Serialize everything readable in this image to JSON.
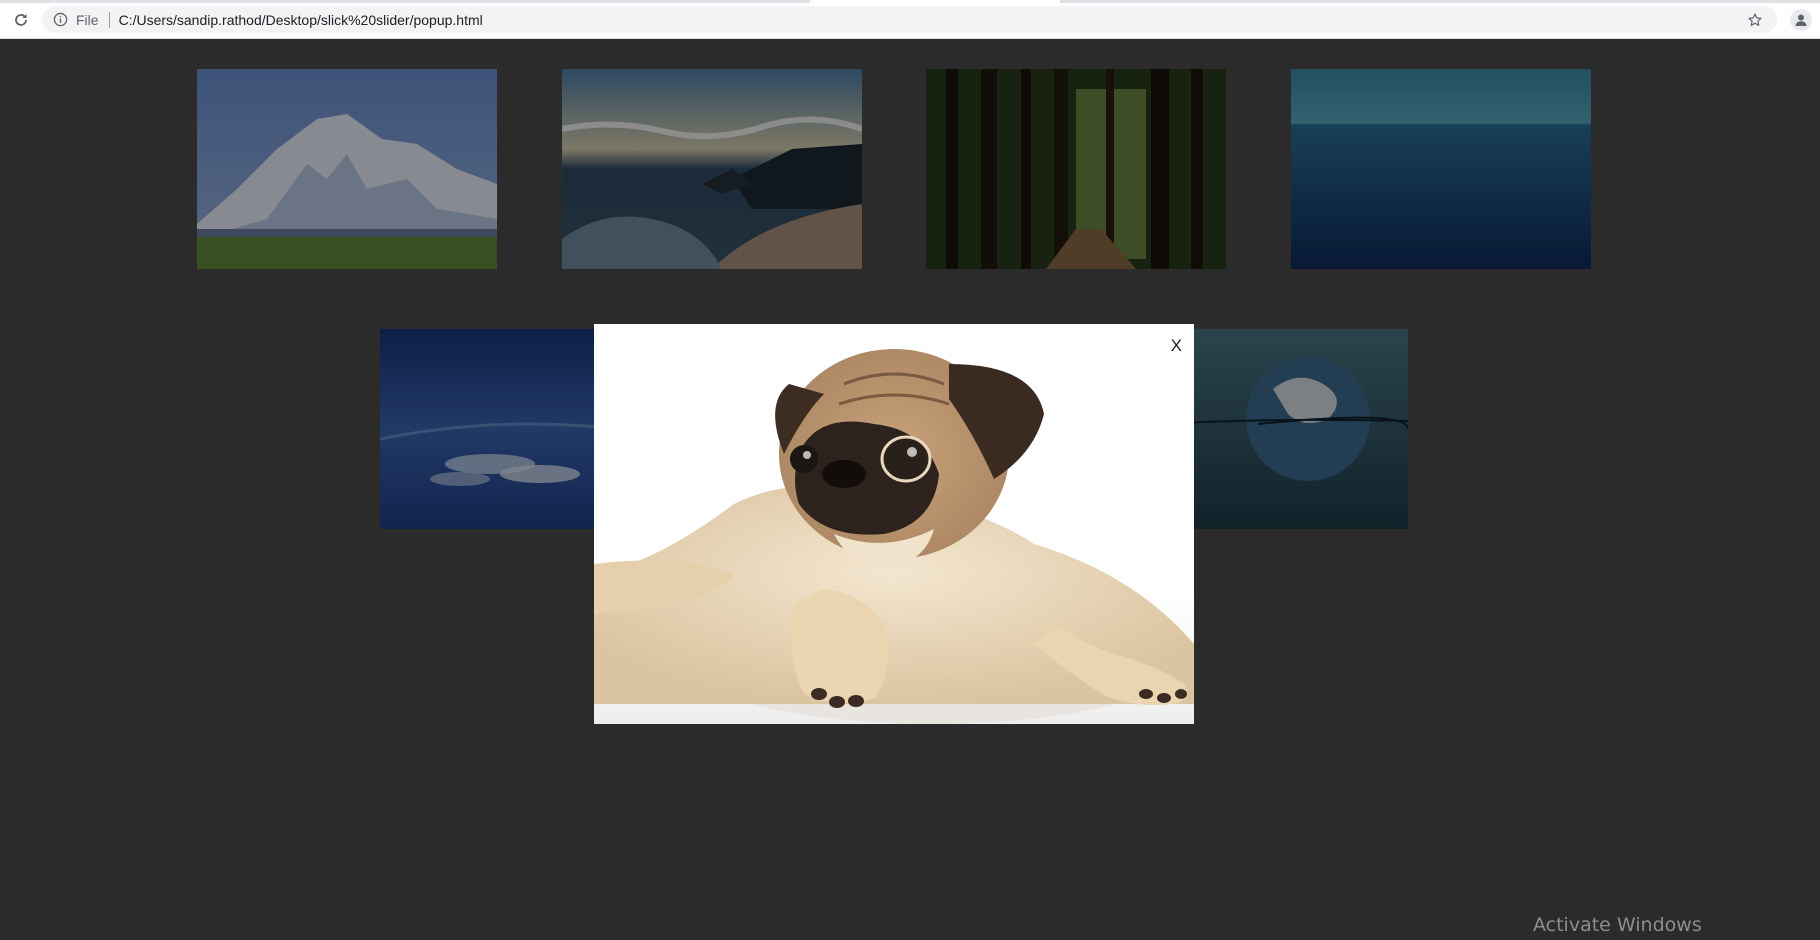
{
  "browser": {
    "scheme_label": "File",
    "url": "C:/Users/sandip.rathod/Desktop/slick%20slider/popup.html",
    "icons": {
      "reload": "reload-icon",
      "info": "info-icon",
      "bookmark": "star-icon",
      "profile": "profile-icon"
    }
  },
  "gallery": {
    "thumbnails": [
      {
        "subject": "snow mountain"
      },
      {
        "subject": "ocean beach"
      },
      {
        "subject": "forest path"
      },
      {
        "subject": "calm sea"
      },
      {
        "subject": "clouds from above"
      },
      {
        "subject": "earth in water"
      }
    ]
  },
  "popup": {
    "close_label": "X",
    "image_subject": "pug puppy"
  },
  "system": {
    "watermark": "Activate Windows"
  }
}
